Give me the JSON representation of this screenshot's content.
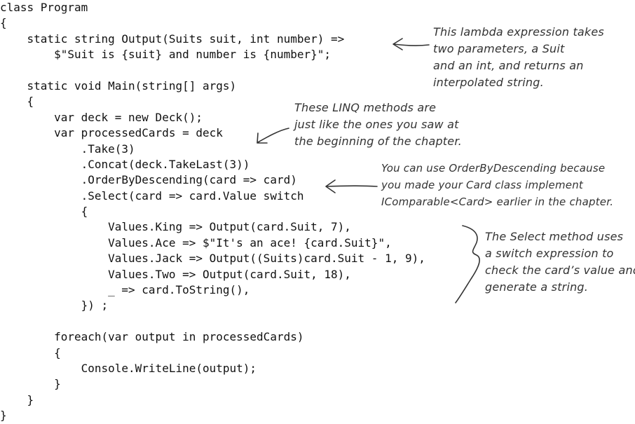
{
  "code": {
    "lines": [
      "class Program",
      "{",
      "    static string Output(Suits suit, int number) =>",
      "        $\"Suit is {suit} and number is {number}\";",
      "",
      "    static void Main(string[] args)",
      "    {",
      "        var deck = new Deck();",
      "        var processedCards = deck",
      "            .Take(3)",
      "            .Concat(deck.TakeLast(3))",
      "            .OrderByDescending(card => card)",
      "            .Select(card => card.Value switch",
      "            {",
      "                Values.King => Output(card.Suit, 7),",
      "                Values.Ace => $\"It's an ace! {card.Suit}\",",
      "                Values.Jack => Output((Suits)card.Suit - 1, 9),",
      "                Values.Two => Output(card.Suit, 18),",
      "                _ => card.ToString(),",
      "            }) ;",
      "",
      "        foreach(var output in processedCards)",
      "        {",
      "            Console.WriteLine(output);",
      "        }",
      "    }",
      "}"
    ]
  },
  "annotations": {
    "lambda": [
      "This lambda expression takes",
      "two parameters, a Suit",
      "and an int, and returns an",
      "interpolated string."
    ],
    "linq": [
      "These LINQ methods are",
      "just like the ones you saw at",
      "the beginning of the chapter."
    ],
    "order": [
      "You can use OrderByDescending because",
      "you made your Card class implement",
      "IComparable<Card> earlier in the chapter."
    ],
    "select": [
      "The Select method uses",
      "a switch expression to",
      "check the card’s value and",
      "generate a string."
    ]
  },
  "colors": {
    "code": "#111111",
    "annotation": "#333333"
  }
}
